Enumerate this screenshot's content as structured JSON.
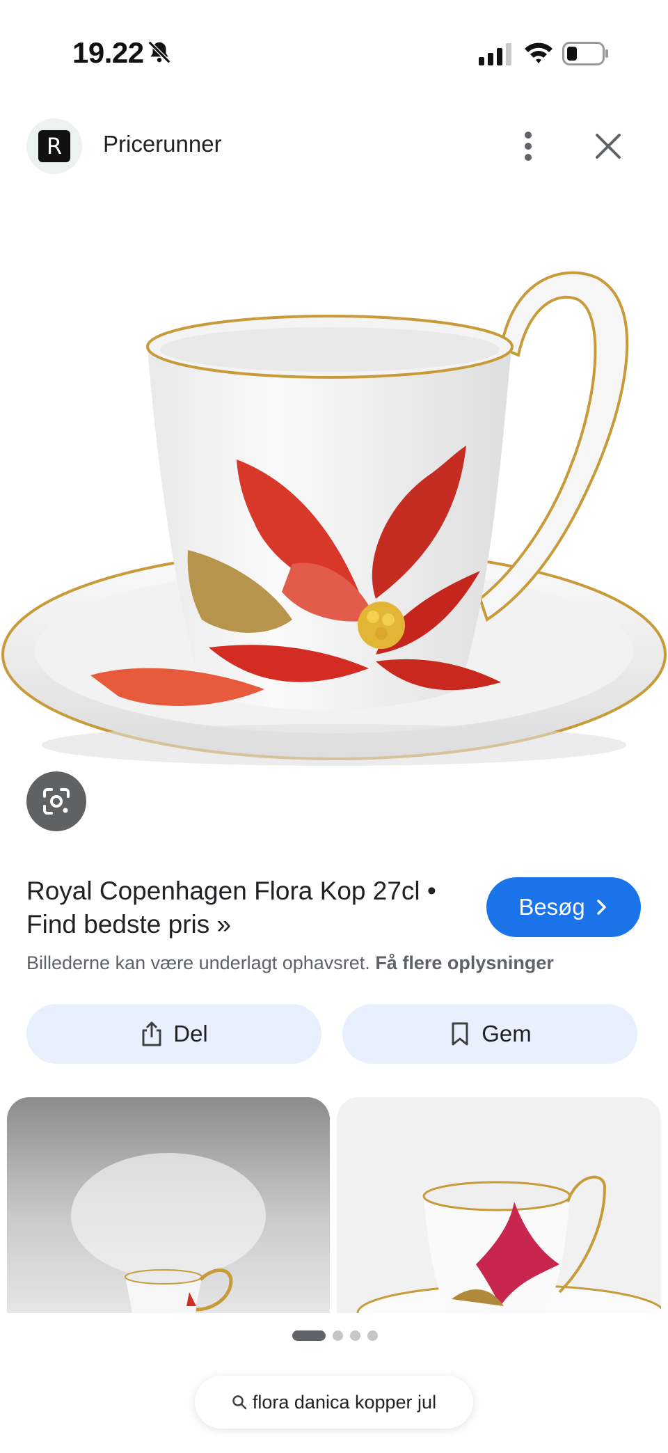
{
  "status_bar": {
    "time": "19.22"
  },
  "header": {
    "source_name": "Pricerunner",
    "logo_letter": "R"
  },
  "product": {
    "title": "Royal Copenhagen Flora Kop 27cl • Find bedste pris »",
    "visit_label": "Besøg",
    "copyright_text": "Billederne kan være underlagt ophavsret.",
    "more_info_label": "Få flere oplysninger"
  },
  "actions": {
    "share_label": "Del",
    "save_label": "Gem"
  },
  "pager": {
    "pages": 4,
    "active_index": 0
  },
  "search": {
    "query": "flora danica kopper jul"
  },
  "colors": {
    "accent": "#1a73e8",
    "action_bg": "#e8effd",
    "text": "#202124",
    "secondary_text": "#5f6368"
  }
}
